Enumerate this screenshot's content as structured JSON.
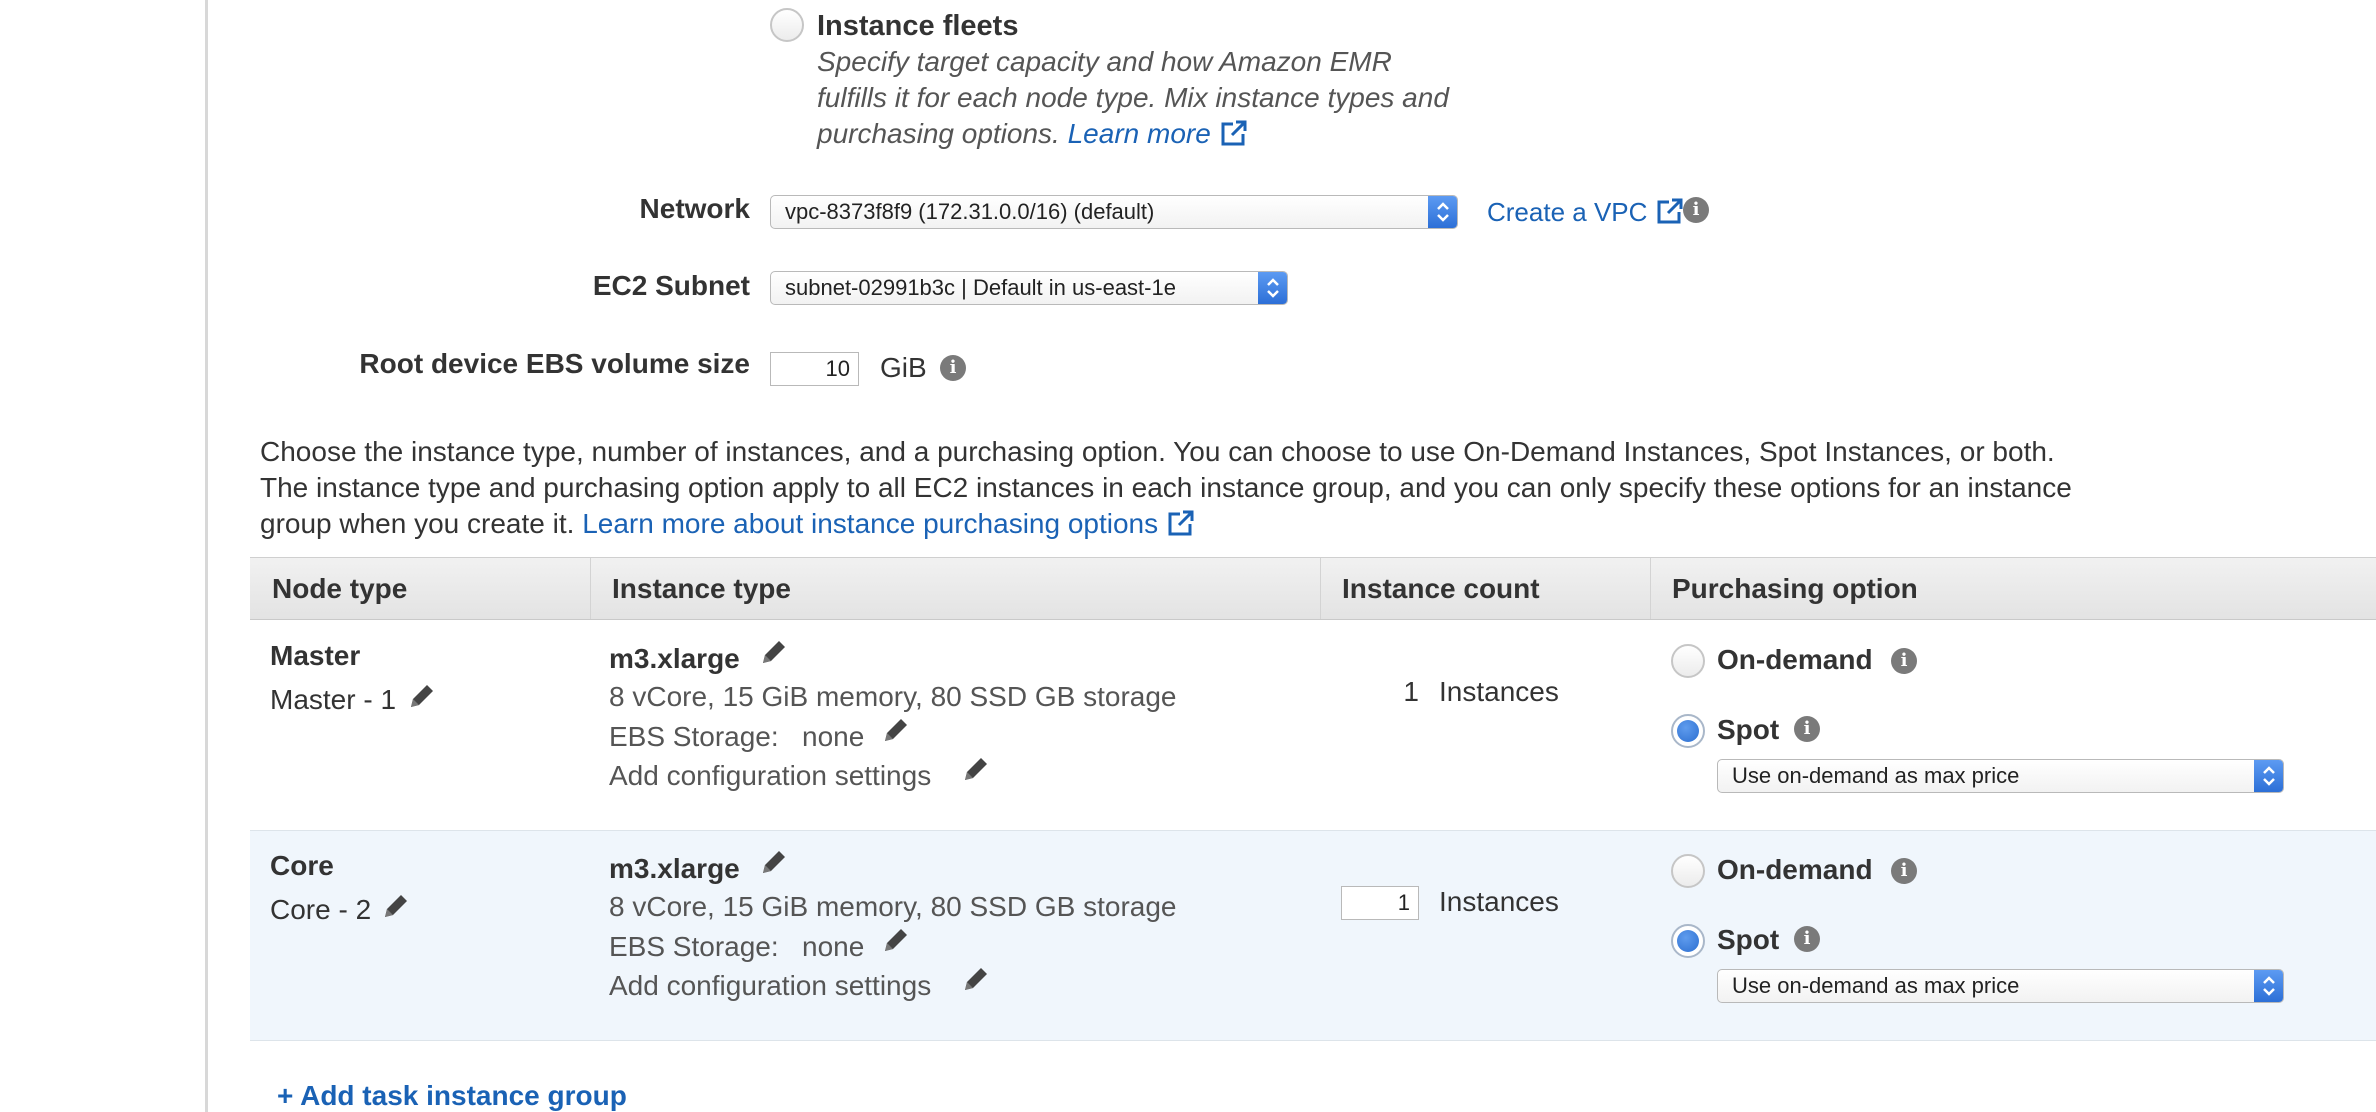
{
  "fleet": {
    "title": "Instance fleets",
    "desc_line1": "Specify target capacity and how Amazon EMR",
    "desc_line2": "fulfills it for each node type. Mix instance types and",
    "desc_line3": "purchasing options.",
    "learn_more": "Learn more"
  },
  "network": {
    "label": "Network",
    "value": "vpc-8373f8f9 (172.31.0.0/16) (default)",
    "create_vpc": "Create a VPC"
  },
  "subnet": {
    "label": "EC2 Subnet",
    "value": "subnet-02991b3c | Default in us-east-1e"
  },
  "ebs": {
    "label": "Root device EBS volume size",
    "value": "10",
    "unit": "GiB"
  },
  "intro": {
    "line1": "Choose the instance type, number of instances, and a purchasing option. You can choose to use On-Demand Instances, Spot Instances, or both.",
    "line2": "The instance type and purchasing option apply to all EC2 instances in each instance group, and you can only specify these options for an instance",
    "line3": "group when you create it.",
    "link": "Learn more about instance purchasing options"
  },
  "table": {
    "headers": [
      "Node type",
      "Instance type",
      "Instance count",
      "Purchasing option"
    ],
    "rows": [
      {
        "node": "Master",
        "node_sub": "Master - 1",
        "instance_type": "m3.xlarge",
        "specs": "8 vCore, 15 GiB memory, 80 SSD GB storage",
        "ebs_label": "EBS Storage:",
        "ebs_value": "none",
        "config": "Add configuration settings",
        "count": "1",
        "count_unit": "Instances",
        "on_demand": "On-demand",
        "spot": "Spot",
        "spot_select": "Use on-demand as max price"
      },
      {
        "node": "Core",
        "node_sub": "Core - 2",
        "instance_type": "m3.xlarge",
        "specs": "8 vCore, 15 GiB memory, 80 SSD GB storage",
        "ebs_label": "EBS Storage:",
        "ebs_value": "none",
        "config": "Add configuration settings",
        "count": "1",
        "count_unit": "Instances",
        "on_demand": "On-demand",
        "spot": "Spot",
        "spot_select": "Use on-demand as max price"
      }
    ]
  },
  "add_task": "+ Add task instance group",
  "colors": {
    "link": "#1a62b5",
    "radio_selected": "#2d6fd0",
    "header_bg": "#e8e8e8",
    "core_row_bg": "#f0f6fc"
  }
}
